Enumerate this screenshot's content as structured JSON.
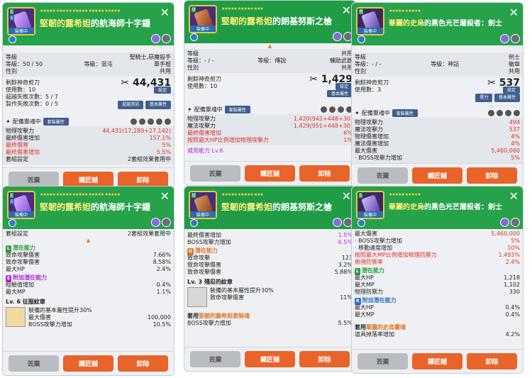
{
  "p1": {
    "stars": "★★★★★ ★★★★★ ★★★★★ ★★★★★ ★★★★★",
    "title_a": "堅韌的露希妲",
    "title_b": "的航海師十字鍾",
    "equipped": "裝備中",
    "rows": [
      {
        "l": "等級",
        "r": "聖騎士,惡魔殺手",
        "c": ""
      },
      {
        "l": "等級：50 / 50",
        "c": "等級：混沌",
        "r": "單手棍"
      },
      {
        "l": "性別",
        "c": "",
        "r": "共用"
      }
    ],
    "scissors": "剩餘神奇剪刀",
    "scissors_val": "44,431",
    "used": "使用數：10",
    "fail": "超越失敗次數：5 / 7",
    "craft_fail": "製作失敗次數：0 / 5",
    "set_btn": "設定",
    "btn_a": "超越資訊",
    "btn_b": "基本屬性",
    "soul": "配備靈魂中",
    "soul_tag": "套裝屬性",
    "stats": [
      {
        "l": "物理攻擊力",
        "r": "44,431(17,289+27,142)",
        "cls": "red"
      },
      {
        "l": "最終傷害增加",
        "r": "157.1%",
        "cls": "red"
      },
      {
        "l": "最終傷害",
        "r": "5%",
        "cls": "red"
      },
      {
        "l": "最終傷害增加",
        "r": "5.5%",
        "cls": "red"
      },
      {
        "l": "套組設定",
        "r": "2套組效果套用中",
        "cls": ""
      }
    ],
    "footer": [
      "丟棄",
      "鐵匠舖",
      "卸除"
    ]
  },
  "p2": {
    "stars": "★★★★★ ★★★★★ ★★★",
    "title_a": "堅韌的露希妲",
    "title_b": "的朗基努斯之槍",
    "equipped": "裝備中",
    "rows": [
      {
        "l": "等級",
        "c": "",
        "r": "共用"
      },
      {
        "l": "等級：- / -",
        "c": "等級：傳說",
        "r": "輔助武器"
      },
      {
        "l": "性別",
        "c": "",
        "r": "共用"
      }
    ],
    "scissors": "剩餘神奇剪刀",
    "scissors_val": "1,429",
    "used": "使用數：10",
    "set_btn": "設定",
    "btn_b": "基本屬性",
    "soul": "配備靈魂中",
    "soul_tag": "套裝屬性",
    "stats": [
      {
        "l": "物理攻擊力",
        "r": "1,420(942+448+30)",
        "cls": "red"
      },
      {
        "l": "魔法攻擊力",
        "r": "1,429(951+448+30)",
        "cls": "red"
      },
      {
        "l": "最終傷害增加",
        "r": "6%",
        "cls": "red"
      },
      {
        "l": "按照最大HP比例增加物理攻擊力",
        "r": "1%",
        "cls": "red"
      }
    ],
    "potential": "威脅能力 Lv.6",
    "footer": [
      "丟棄",
      "鐵匠舖",
      "卸除"
    ]
  },
  "p3": {
    "stars": "★★★★★ ★★★★★",
    "title_a": "華麗的史烏",
    "title_b": "的黑色光芒屠殺者：劍士",
    "equipped": "裝備中",
    "rows": [
      {
        "l": "等級",
        "c": "",
        "r": "劍士"
      },
      {
        "l": "等級：- / -",
        "c": "等級：神話",
        "r": "徽章"
      },
      {
        "l": "性別",
        "c": "",
        "r": "共用"
      }
    ],
    "scissors": "剩餘神奇剪刀",
    "scissors_val": "537",
    "used": "使用數：3",
    "set_btn": "設定",
    "btn_a": "星力",
    "btn_b": "基本屬性",
    "soul": "配備靈魂中",
    "soul_tag": "套裝屬性",
    "stats": [
      {
        "l": "物理攻擊力",
        "r": "494",
        "cls": "red"
      },
      {
        "l": "魔法攻擊力",
        "r": "537",
        "cls": "red"
      },
      {
        "l": "物理傷害增加",
        "r": "4%",
        "cls": "red"
      },
      {
        "l": "魔法傷害增加",
        "r": "4%",
        "cls": "red"
      },
      {
        "l": "最大傷害",
        "r": "5,460,000",
        "cls": "red"
      },
      {
        "l": "· BOSS攻擊力增加",
        "r": "5%",
        "cls": "red"
      }
    ],
    "footer": [
      "丟棄",
      "鐵匠舖",
      "卸除"
    ]
  },
  "p4": {
    "stars": "★★★★★ ★★★★★ ★★★★★ ★★★★★ ★★★★★",
    "title_a": "堅韌的露希妲",
    "title_b": "的航海師十字鍾",
    "equipped": "裝備中",
    "top_row": {
      "l": "套組設定",
      "r": "2套組效果套用中"
    },
    "pot_title": "潛在能力",
    "pot": [
      {
        "l": "致命攻擊傷害",
        "r": "7.66%"
      },
      {
        "l": "致命攻擊傷害",
        "r": "8.58%"
      },
      {
        "l": "最大HP",
        "r": "2.4%"
      }
    ],
    "add_title": "附加潛在能力",
    "add": [
      {
        "l": "經驗值增加",
        "r": "0.4%"
      },
      {
        "l": "最大MP",
        "r": "1.1%"
      }
    ],
    "skill": "Lv. 6 征服紋章",
    "skill_desc": "裝備的基本屬性提升30%",
    "skill_rows": [
      {
        "l": "最大傷害",
        "r": "100,000"
      },
      {
        "l": "BOSS攻擊力增加",
        "r": "10.5%"
      }
    ],
    "footer": [
      "丟棄",
      "鐵匠舖",
      "卸除"
    ]
  },
  "p5": {
    "stars": "★★★★★ ★★★★★ ★★★",
    "title_a": "堅韌的露希妲",
    "title_b": "的朗基努斯之槍",
    "equipped": "裝備中",
    "top": [
      {
        "l": "最終傷害增加",
        "r": "1.5%",
        "cls": "pur"
      },
      {
        "l": "BOSS攻擊力增加",
        "r": "6.5%",
        "cls": "pur"
      }
    ],
    "pot_title": "潛在能力",
    "pot": [
      {
        "l": "致命攻擊",
        "r": "123"
      },
      {
        "l": "致命攻擊傷害",
        "r": "3.2%"
      },
      {
        "l": "致命攻擊傷害",
        "r": "5.88%"
      }
    ],
    "skill": "Lv. 3 殘忍的紋章",
    "skill_desc": "裝備的基本屬性提升30%",
    "skill_rows": [
      {
        "l": "致命攻擊傷害",
        "r": "11%"
      }
    ],
    "set_title_a": "套用",
    "set_title_b": "堅韌的露希妲套裝魂",
    "set_rows": [
      {
        "l": "BOSS攻擊力增加",
        "r": "5.5%"
      }
    ],
    "footer": [
      "丟棄",
      "鐵匠舖",
      "卸除"
    ]
  },
  "p6": {
    "stars": "★★★★★ ★★★★★",
    "title_a": "華麗的史烏",
    "title_b": "的黑色光芒屠殺者：劍士",
    "equipped": "裝備中",
    "top": [
      {
        "l": "最大傷害",
        "r": "5,460,000",
        "cls": "red"
      },
      {
        "l": "· BOSS攻擊力增加",
        "r": "5%",
        "cls": "red"
      },
      {
        "l": "· 移動速度增加",
        "r": "10%",
        "cls": "red"
      },
      {
        "l": "按照最大MP比例增加物理防禦力",
        "r": "1.493%",
        "cls": "red"
      },
      {
        "l": "無視防禦率",
        "r": "2.4%",
        "cls": "red"
      }
    ],
    "pot_title": "潛在能力",
    "pot": [
      {
        "l": "最大HP",
        "r": "1,218"
      },
      {
        "l": "最大MP",
        "r": "1,102"
      },
      {
        "l": "物理防禦力",
        "r": "330"
      }
    ],
    "add_title": "附加潛在能力",
    "add": [
      {
        "l": "最大HP",
        "r": "0.4%"
      },
      {
        "l": "最大MP",
        "r": "0.4%"
      }
    ],
    "set_title_a": "套用",
    "set_title_b": "華麗的史烏靈魂",
    "set_rows": [
      {
        "l": "道具掉落率增加",
        "r": "4.2%"
      }
    ],
    "footer": [
      "丟棄",
      "鐵匠舖",
      "卸除"
    ]
  }
}
